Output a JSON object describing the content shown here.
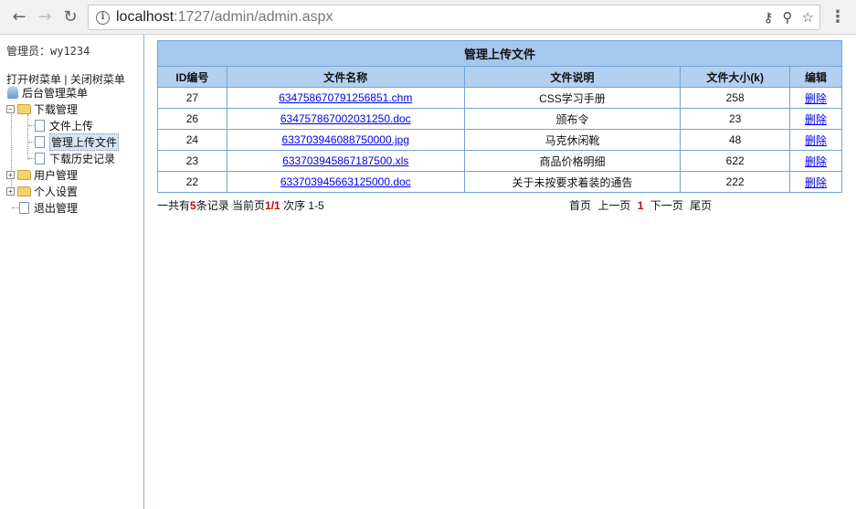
{
  "browser": {
    "url_host": "localhost",
    "url_rest": ":1727/admin/admin.aspx",
    "icons": [
      "back-icon",
      "forward-icon",
      "reload-icon",
      "info-icon",
      "key-icon",
      "zoom-icon",
      "star-icon",
      "menu-icon"
    ]
  },
  "sidebar": {
    "admin_label": "管理员：wy1234",
    "open_tree": "打开树菜单",
    "separator": "|",
    "close_tree": "关闭树菜单",
    "root": "后台管理菜单",
    "nodes": [
      {
        "label": "下载管理",
        "children": [
          "文件上传",
          "管理上传文件",
          "下载历史记录"
        ]
      },
      {
        "label": "用户管理"
      },
      {
        "label": "个人设置"
      },
      {
        "label": "退出管理"
      }
    ]
  },
  "table": {
    "caption": "管理上传文件",
    "headers": [
      "ID编号",
      "文件名称",
      "文件说明",
      "文件大小(k)",
      "编辑"
    ],
    "rows": [
      {
        "id": "27",
        "file": "634758670791256851.chm",
        "desc": "CSS学习手册",
        "size": "258",
        "action": "删除"
      },
      {
        "id": "26",
        "file": "634757867002031250.doc",
        "desc": "颁布令",
        "size": "23",
        "action": "删除"
      },
      {
        "id": "24",
        "file": "633703946088750000.jpg",
        "desc": "马克休闲靴",
        "size": "48",
        "action": "删除"
      },
      {
        "id": "23",
        "file": "633703945867187500.xls",
        "desc": "商品价格明细",
        "size": "622",
        "action": "删除"
      },
      {
        "id": "22",
        "file": "633703945663125000.doc",
        "desc": "关于未按要求着装的通告",
        "size": "222",
        "action": "删除"
      }
    ]
  },
  "pager": {
    "prefix": "一共有",
    "count": "5",
    "mid": "条记录 当前页",
    "page": "1/1",
    "order": "次序 1-5",
    "first": "首页",
    "prev": "上一页",
    "current": "1",
    "next": "下一页",
    "last": "尾页"
  }
}
